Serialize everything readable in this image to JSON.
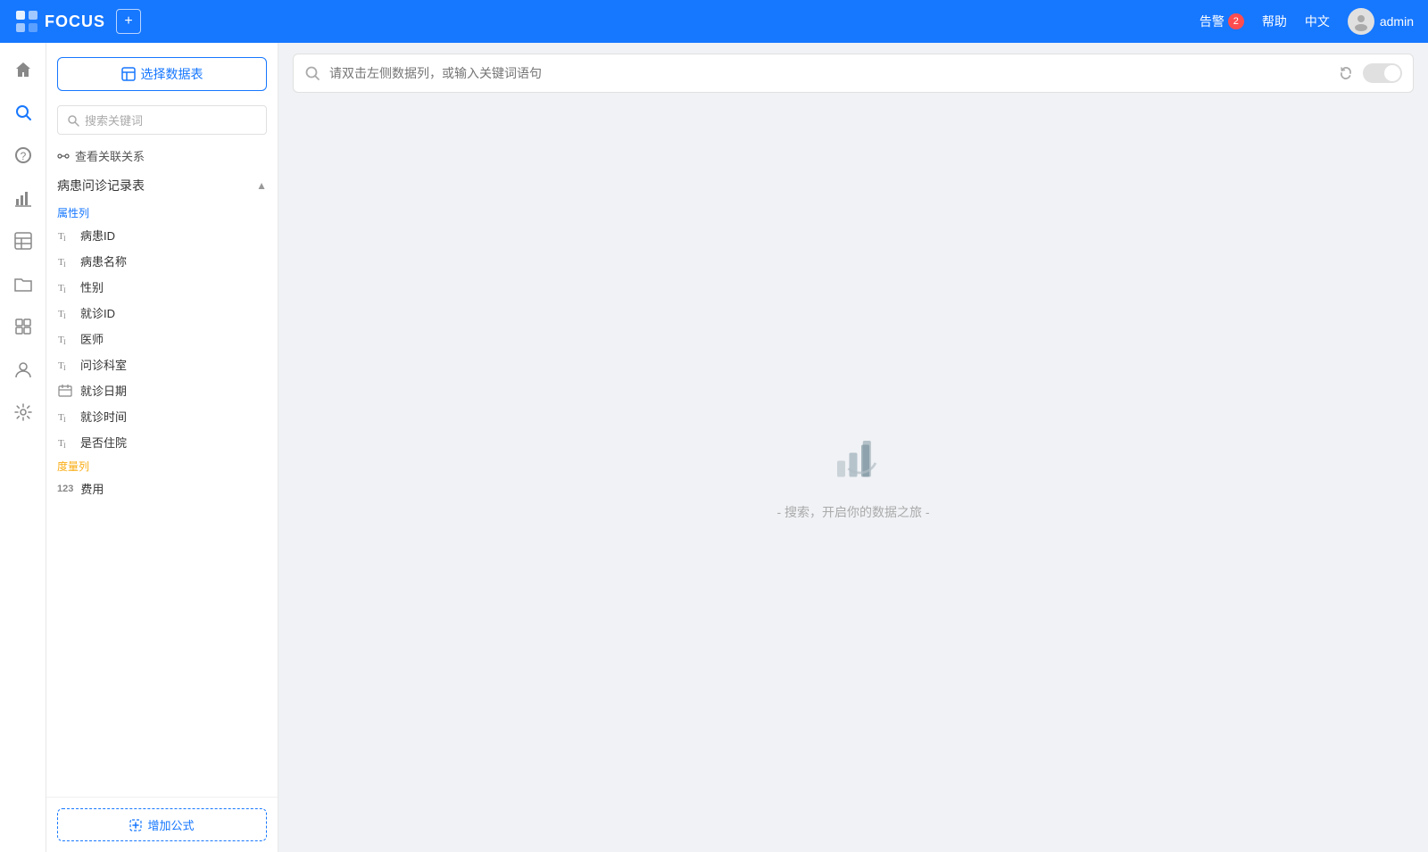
{
  "topbar": {
    "logo_text": "FOCUS",
    "add_btn_label": "+",
    "alert_label": "告警",
    "alert_count": "2",
    "help_label": "帮助",
    "lang_label": "中文",
    "user_label": "admin"
  },
  "icon_sidebar": {
    "items": [
      {
        "name": "home-icon",
        "icon": "⌂",
        "active": false
      },
      {
        "name": "search-icon",
        "icon": "⚲",
        "active": true
      },
      {
        "name": "help-icon",
        "icon": "?",
        "active": false
      },
      {
        "name": "chart-icon",
        "icon": "▦",
        "active": false
      },
      {
        "name": "table-icon",
        "icon": "⊞",
        "active": false
      },
      {
        "name": "folder-icon",
        "icon": "⊟",
        "active": false
      },
      {
        "name": "data-icon",
        "icon": "◫",
        "active": false
      },
      {
        "name": "user-icon",
        "icon": "⊙",
        "active": false
      },
      {
        "name": "settings-icon",
        "icon": "✱",
        "active": false
      }
    ]
  },
  "data_sidebar": {
    "select_table_btn": "选择数据表",
    "search_placeholder": "搜索关键词",
    "view_relation_label": "查看关联关系",
    "table_name": "病患问诊记录表",
    "attr_label": "属性列",
    "measure_label": "度量列",
    "columns": [
      {
        "name": "病患ID",
        "type": "text"
      },
      {
        "name": "病患名称",
        "type": "text"
      },
      {
        "name": "性别",
        "type": "text"
      },
      {
        "name": "就诊ID",
        "type": "text"
      },
      {
        "name": "医师",
        "type": "text"
      },
      {
        "name": "问诊科室",
        "type": "text"
      },
      {
        "name": "就诊日期",
        "type": "date"
      },
      {
        "name": "就诊时间",
        "type": "text"
      },
      {
        "name": "是否住院",
        "type": "text"
      }
    ],
    "measures": [
      {
        "name": "费用",
        "type": "number"
      }
    ],
    "add_formula_btn": "增加公式"
  },
  "search_bar": {
    "placeholder": "请双击左侧数据列，或输入关键词语句"
  },
  "empty_state": {
    "text": "- 搜索，开启你的数据之旅 -"
  }
}
